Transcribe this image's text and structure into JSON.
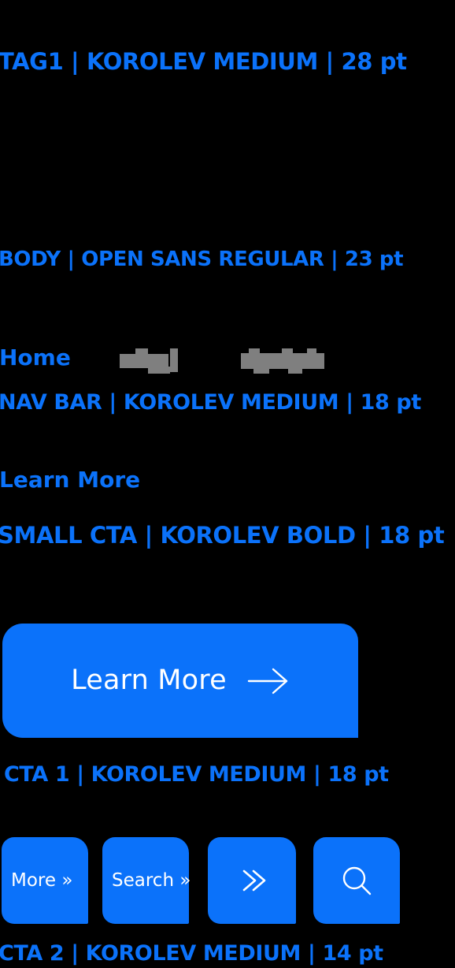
{
  "page": {
    "background_color": "#000000",
    "accent_color": "#0b72fa",
    "on_accent_color": "#ffffff",
    "redaction_color": "#7f7f7f"
  },
  "specimens": {
    "tag": {
      "spec": "TAG1 | KOROLEV MEDIUM | 28 pt"
    },
    "body": {
      "spec": "BODY | OPEN SANS REGULAR | 23 pt"
    },
    "nav": {
      "items": [
        {
          "label": "Home",
          "redacted": false
        },
        {
          "label": "",
          "redacted": true
        },
        {
          "label": "",
          "redacted": true
        }
      ],
      "spec": "NAV BAR | KOROLEV MEDIUM | 18 pt"
    },
    "small_cta": {
      "sample": "Learn More",
      "spec": "SMALL CTA | KOROLEV BOLD | 18 pt"
    },
    "cta1": {
      "button_label": "Learn More",
      "button_icon": "arrow-right-icon",
      "spec": "CTA 1 | KOROLEV MEDIUM | 18 pt"
    },
    "cta2": {
      "buttons": [
        {
          "label": "More »",
          "icon": null
        },
        {
          "label": "Search »",
          "icon": null
        },
        {
          "label": "",
          "icon": "double-chevron-right-icon"
        },
        {
          "label": "",
          "icon": "search-icon"
        }
      ],
      "spec": "CTA 2 | KOROLEV MEDIUM | 14 pt"
    }
  }
}
